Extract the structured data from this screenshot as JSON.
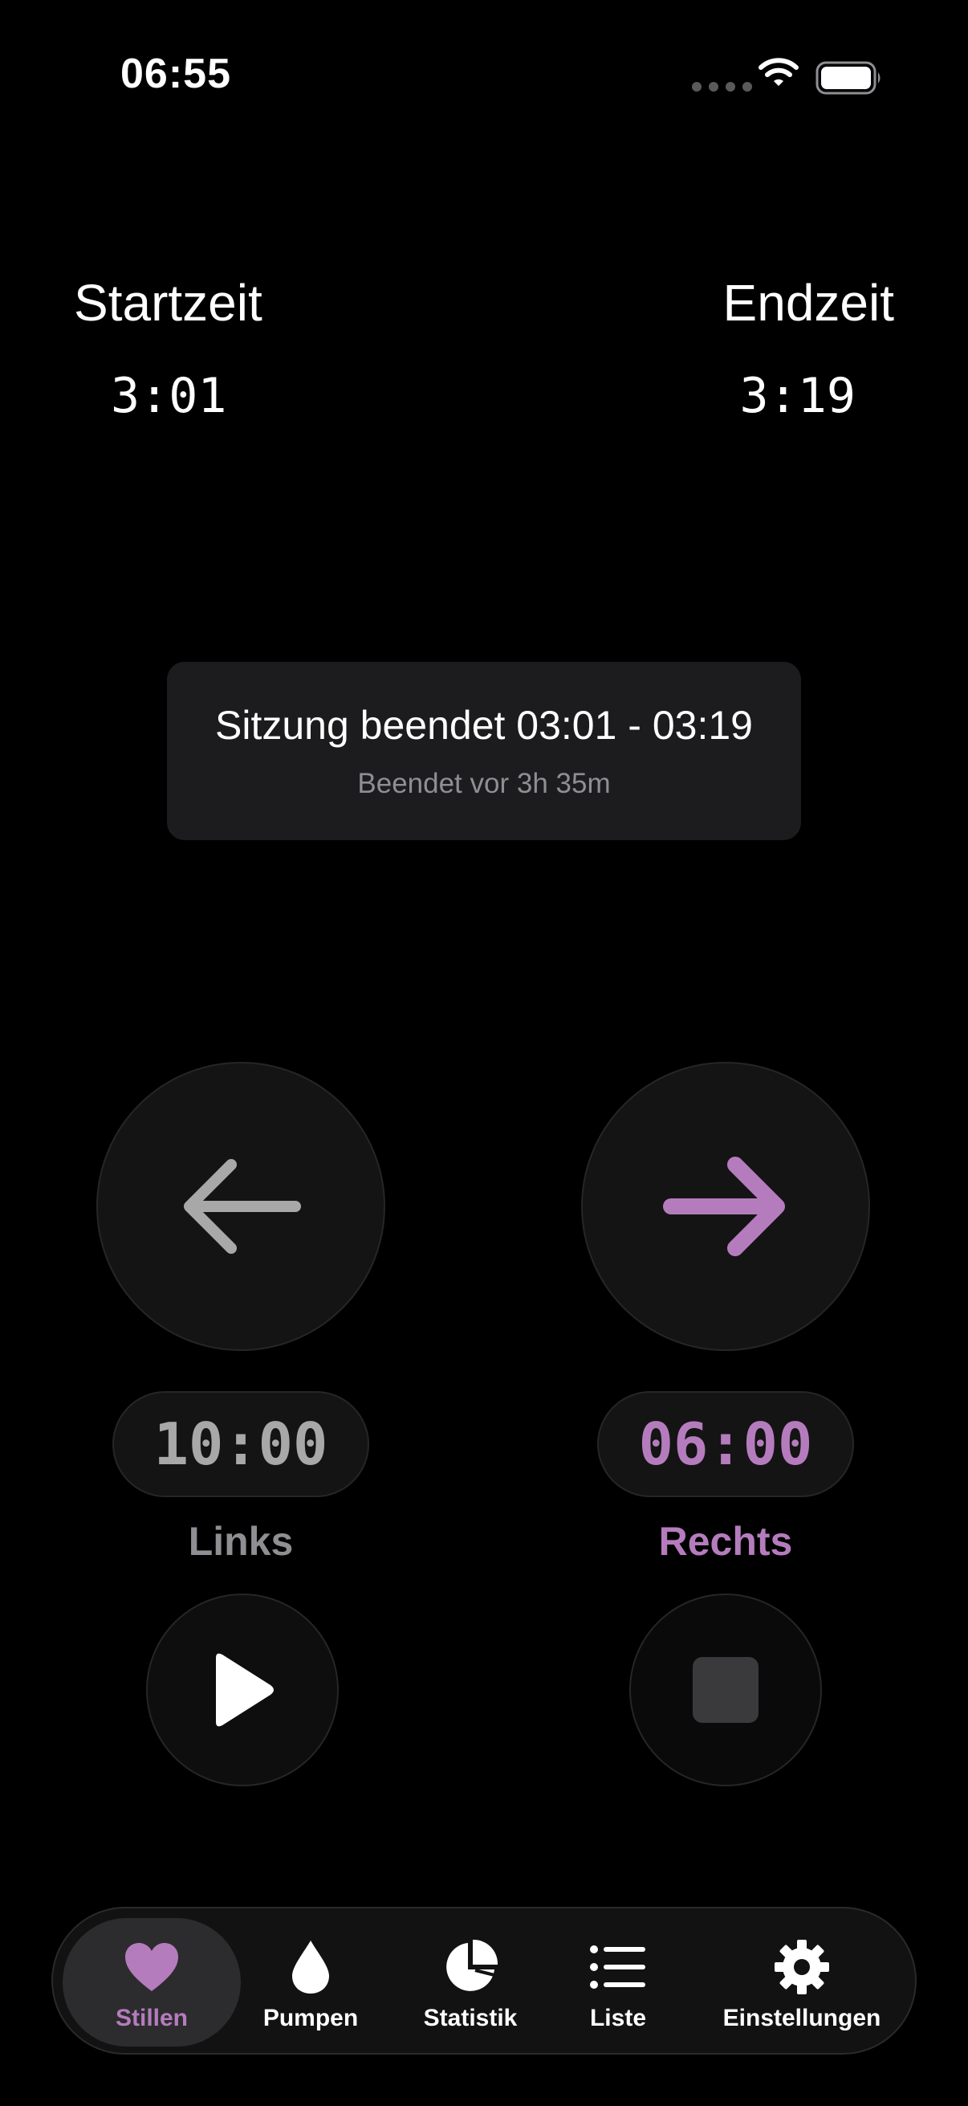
{
  "status_bar": {
    "time": "06:55"
  },
  "header": {
    "start_label": "Startzeit",
    "start_time": "3:01",
    "end_label": "Endzeit",
    "end_time": "3:19"
  },
  "session": {
    "title": "Sitzung beendet 03:01 - 03:19",
    "subtitle": "Beendet vor 3h 35m"
  },
  "left": {
    "timer": "10:00",
    "label": "Links"
  },
  "right": {
    "timer": "06:00",
    "label": "Rechts"
  },
  "tabs": [
    {
      "label": "Stillen",
      "icon": "heart-icon",
      "active": true
    },
    {
      "label": "Pumpen",
      "icon": "drop-icon"
    },
    {
      "label": "Statistik",
      "icon": "pie-chart-icon"
    },
    {
      "label": "Liste",
      "icon": "list-icon"
    },
    {
      "label": "Einstellungen",
      "icon": "gear-icon"
    }
  ],
  "colors": {
    "accent": "#b57cbd",
    "background": "#000000",
    "card": "#1c1c1e",
    "inactive": "#8e8e93"
  }
}
